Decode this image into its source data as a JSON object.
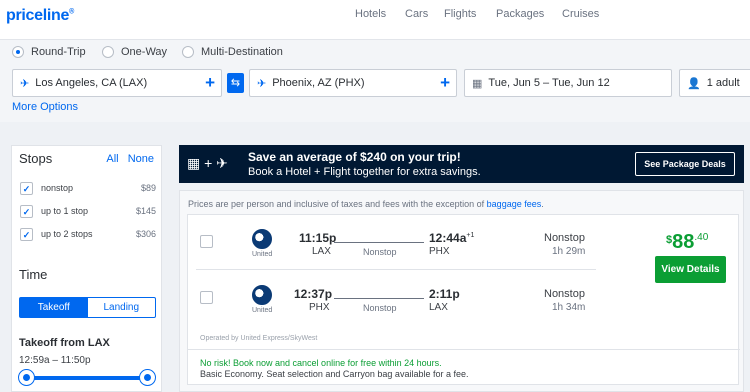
{
  "header": {
    "logo": "priceline",
    "logo_mark": "®",
    "nav": [
      "Hotels",
      "Cars",
      "Flights",
      "Packages",
      "Cruises"
    ]
  },
  "search": {
    "trip_types": [
      "Round-Trip",
      "One-Way",
      "Multi-Destination"
    ],
    "selected_trip_type": "Round-Trip",
    "origin": "Los Angeles, CA (LAX)",
    "destination": "Phoenix, AZ (PHX)",
    "dates": "Tue, Jun 5 – Tue, Jun 12",
    "travelers": "1 adult",
    "more_options": "More Options"
  },
  "filters": {
    "stops_title": "Stops",
    "all": "All",
    "none": "None",
    "stops": [
      {
        "label": "nonstop",
        "price": "$89",
        "checked": true
      },
      {
        "label": "up to 1 stop",
        "price": "$145",
        "checked": true
      },
      {
        "label": "up to 2 stops",
        "price": "$306",
        "checked": true
      }
    ],
    "time_title": "Time",
    "tabs": [
      "Takeoff",
      "Landing"
    ],
    "active_tab": "Takeoff",
    "takeoff_from": "Takeoff from LAX",
    "takeoff_range": "12:59a – 11:50p"
  },
  "banner": {
    "headline": "Save an average of $240 on your trip!",
    "subline": "Book a Hotel + Flight together for extra savings.",
    "button": "See Package Deals"
  },
  "results": {
    "note_prefix": "Prices are per person and inclusive of taxes and fees with the exception of ",
    "note_link": "baggage fees",
    "note_suffix": ".",
    "legs": [
      {
        "airline": "United",
        "dep_time": "11:15p",
        "dep_code": "LAX",
        "arr_time": "12:44a",
        "arr_plus": "+1",
        "arr_code": "PHX",
        "stop_label": "Nonstop",
        "stops": "Nonstop",
        "duration": "1h 29m"
      },
      {
        "airline": "United",
        "dep_time": "12:37p",
        "dep_code": "PHX",
        "arr_time": "2:11p",
        "arr_plus": "",
        "arr_code": "LAX",
        "stop_label": "Nonstop",
        "stops": "Nonstop",
        "duration": "1h 34m"
      }
    ],
    "price_currency": "$",
    "price_main": "88",
    "price_cents": ".40",
    "view_button": "View Details",
    "operated_by": "Operated by United Express/SkyWest",
    "free_cancel": "No risk! Book now and cancel online for free within 24 hours.",
    "basic_note": "Basic Economy. Seat selection and Carryon bag available for a fee."
  },
  "colors": {
    "brand": "#0068ef",
    "price_green": "#0b9e34",
    "banner_bg": "#001833"
  }
}
